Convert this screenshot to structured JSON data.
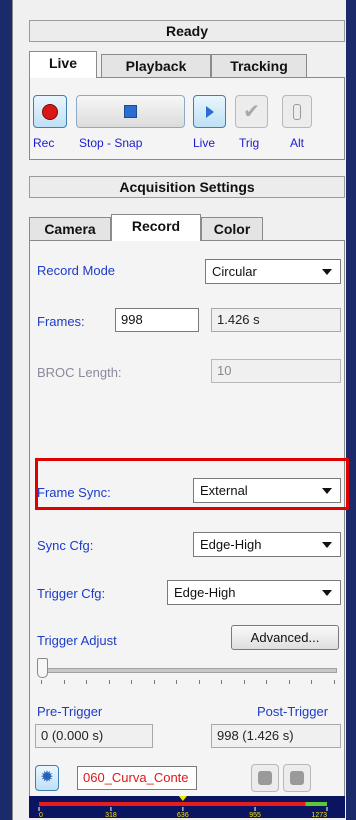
{
  "status": "Ready",
  "mode_tabs": [
    {
      "label": "Live",
      "active": true
    },
    {
      "label": "Playback",
      "active": false
    },
    {
      "label": "Tracking",
      "active": false
    }
  ],
  "toolbar": {
    "rec_label": "Rec",
    "stop_snap_label": "Stop - Snap",
    "live_label": "Live",
    "trig_label": "Trig",
    "alt_label": "Alt"
  },
  "acquisition_title": "Acquisition Settings",
  "settings_tabs": [
    {
      "label": "Camera",
      "active": false
    },
    {
      "label": "Record",
      "active": true
    },
    {
      "label": "Color",
      "active": false
    }
  ],
  "record": {
    "record_mode_label": "Record Mode",
    "record_mode_value": "Circular",
    "frames_label": "Frames:",
    "frames_value": "998",
    "frames_time": "1.426 s",
    "broc_label": "BROC Length:",
    "broc_value": "10",
    "frame_sync_label": "Frame Sync:",
    "frame_sync_value": "External",
    "sync_cfg_label": "Sync Cfg:",
    "sync_cfg_value": "Edge-High",
    "trigger_cfg_label": "Trigger Cfg:",
    "trigger_cfg_value": "Edge-High",
    "trigger_adjust_label": "Trigger Adjust",
    "advanced_label": "Advanced...",
    "pre_trigger_label": "Pre-Trigger",
    "post_trigger_label": "Post-Trigger",
    "pre_trigger_value": "0 (0.000 s)",
    "post_trigger_value": "998 (1.426 s)",
    "filename": "060_Curva_Conte"
  },
  "buffer_scale": {
    "ticks": [
      "0",
      "318",
      "636",
      "955",
      "1273"
    ],
    "max": 1273,
    "marker_value": 636,
    "red_end_value": 1178,
    "colors": {
      "red": "#e81c1c",
      "green": "#5cc832",
      "yellow": "#f5e600",
      "background": "#0a1460"
    }
  },
  "colors": {
    "highlight": "#e00000",
    "link_label": "#1c3cc8",
    "window_background": "#1b2a6b"
  }
}
